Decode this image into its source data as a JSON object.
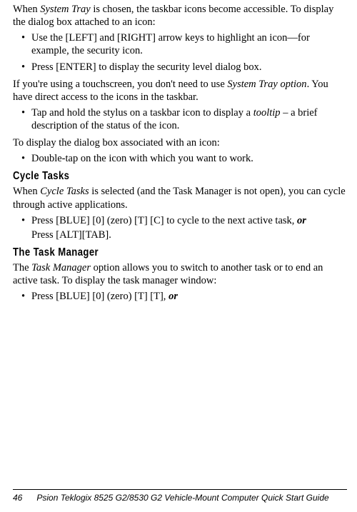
{
  "p1_pre": "When ",
  "p1_em1": "System Tray",
  "p1_post": " is chosen, the taskbar icons become accessible. To display the dialog box attached to an icon:",
  "b1": "Use the [LEFT] and [RIGHT] arrow keys to highlight an icon—for example, the security icon.",
  "b2": "Press [ENTER] to display the security level dialog box.",
  "p2_pre": "If you're using a touchscreen, you don't need to use ",
  "p2_em1": "System Tray option",
  "p2_post": ". You have direct access to the icons in the taskbar.",
  "b3_pre": "Tap and hold the stylus on a taskbar icon to display a ",
  "b3_em": "tooltip",
  "b3_post": " – a brief description of the status of the icon.",
  "p3": "To display the dialog box associated with an icon:",
  "b4": "Double-tap on the icon with which you want to work.",
  "h1": "Cycle Tasks",
  "p4_pre": "When ",
  "p4_em": "Cycle Tasks",
  "p4_post": " is selected (and the Task Manager is not open), you can cycle through active applications.",
  "b5_pre": "Press [BLUE] [0] (zero) [T] [C] to cycle to the next active task, ",
  "b5_em": "or",
  "b5_sub": "Press [ALT][TAB].",
  "h2": "The Task Manager",
  "p5_pre": "The ",
  "p5_em": "Task Manager",
  "p5_post": " option allows you to switch to another task or to end an active task. To display the task manager window:",
  "b6_pre": "Press [BLUE] [0] (zero) [T] [T], ",
  "b6_em": "or",
  "footer_page": "46",
  "footer_title": "Psion Teklogix 8525 G2/8530 G2 Vehicle-Mount Computer Quick Start Guide",
  "bullet": "•"
}
